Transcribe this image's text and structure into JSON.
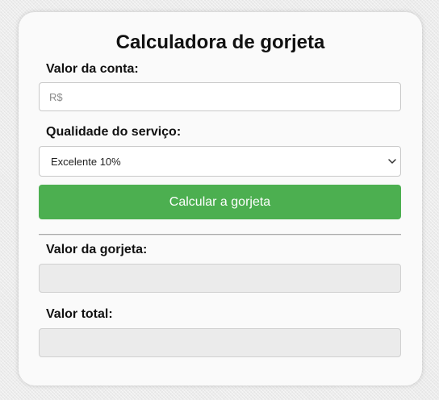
{
  "app": {
    "title": "Calculadora de gorjeta"
  },
  "bill": {
    "label": "Valor da conta:",
    "value": "",
    "placeholder": "R$"
  },
  "service": {
    "label": "Qualidade do serviço:",
    "selected": "Excelente 10%",
    "icon": "chevron-down-icon"
  },
  "actions": {
    "calculate_label": "Calcular a gorjeta",
    "calculate_color": "#4caf50"
  },
  "results": {
    "tip_label": "Valor da gorjeta:",
    "tip_value": "",
    "total_label": "Valor total:",
    "total_value": ""
  }
}
